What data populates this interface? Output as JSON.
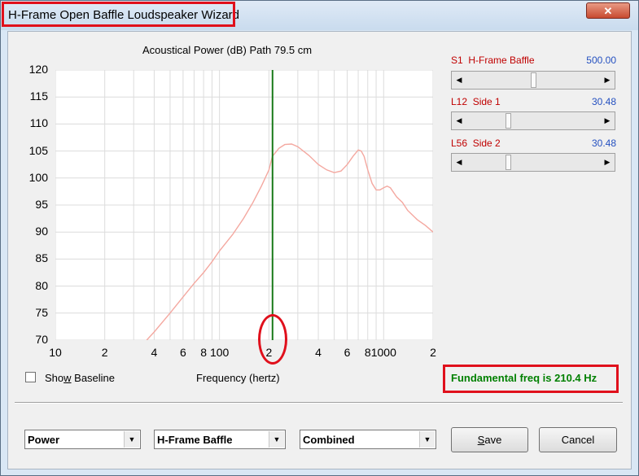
{
  "window": {
    "title": "H-Frame Open Baffle Loudspeaker Wizard",
    "close_glyph": "✕",
    "close_icon": "close-icon"
  },
  "annotation_color": "#e0101c",
  "chart_data": {
    "type": "line",
    "title": "Acoustical Power (dB)   Path 79.5 cm",
    "xlabel": "Frequency (hertz)",
    "ylabel": "",
    "x_scale": "log",
    "xlim": [
      10,
      2000
    ],
    "ylim": [
      70,
      120
    ],
    "grid": true,
    "y_ticks": [
      "120",
      "115",
      "110",
      "105",
      "100",
      "95",
      "90",
      "85",
      "80",
      "75",
      "70"
    ],
    "x_ticks": [
      {
        "label": "10",
        "x": 10
      },
      {
        "label": "2",
        "x": 20
      },
      {
        "label": "4",
        "x": 40
      },
      {
        "label": "6",
        "x": 60
      },
      {
        "label": "8",
        "x": 80
      },
      {
        "label": "100",
        "x": 100
      },
      {
        "label": "2",
        "x": 200
      },
      {
        "label": "4",
        "x": 400
      },
      {
        "label": "6",
        "x": 600
      },
      {
        "label": "8",
        "x": 800
      },
      {
        "label": "1000",
        "x": 1000
      },
      {
        "label": "2",
        "x": 2000
      }
    ],
    "marker_line": {
      "x": 210.4,
      "color": "#1a7a1a"
    },
    "series": [
      {
        "color": "#f4a8a0",
        "x": [
          36,
          40,
          50,
          60,
          70,
          80,
          90,
          100,
          120,
          140,
          160,
          180,
          200,
          210,
          230,
          250,
          275,
          300,
          350,
          400,
          450,
          500,
          550,
          600,
          650,
          700,
          730,
          760,
          800,
          850,
          900,
          950,
          1000,
          1050,
          1100,
          1200,
          1300,
          1400,
          1600,
          1800,
          2000
        ],
        "y": [
          70,
          71.5,
          75,
          78,
          80.5,
          82.5,
          84.5,
          86.5,
          89.5,
          92.5,
          95.5,
          98.5,
          101.5,
          104,
          105.5,
          106.2,
          106.3,
          105.8,
          104.2,
          102.5,
          101.5,
          101,
          101.3,
          102.5,
          104,
          105.2,
          105,
          104,
          101.5,
          99,
          97.8,
          97.8,
          98.2,
          98.5,
          98.2,
          96.5,
          95.5,
          94,
          92.3,
          91.2,
          90
        ]
      }
    ]
  },
  "show_baseline": {
    "label": "Show Baseline",
    "checked": false
  },
  "fundamental": "Fundamental freq is 210.4 Hz",
  "sliders": [
    {
      "id": "S1",
      "label": "H-Frame Baffle",
      "value": "500.00"
    },
    {
      "id": "L12",
      "label": "Side 1",
      "value": "30.48"
    },
    {
      "id": "L56",
      "label": "Side 2",
      "value": "30.48"
    }
  ],
  "slider_glyphs": {
    "left": "◀",
    "right": "▶"
  },
  "dropdowns": [
    {
      "value": "Power"
    },
    {
      "value": "H-Frame Baffle"
    },
    {
      "value": "Combined"
    }
  ],
  "dropdown_glyph": "▼",
  "buttons": {
    "save": "Save",
    "cancel": "Cancel"
  }
}
